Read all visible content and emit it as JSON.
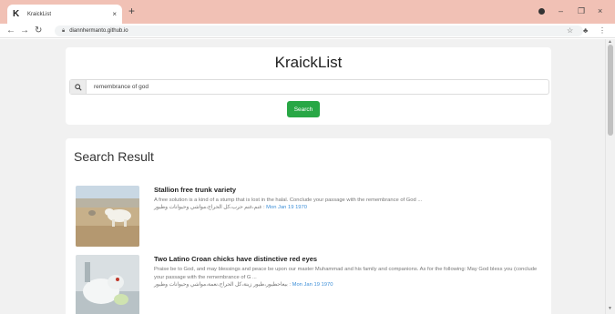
{
  "browser": {
    "tab_favicon": "K",
    "tab_title": "KraickList",
    "tab_close": "×",
    "new_tab": "+",
    "url": "diannhermanto.github.io",
    "minimize": "–",
    "maximize": "❐",
    "close": "×"
  },
  "page": {
    "site_title": "KraickList",
    "search": {
      "value": "remembrance of god",
      "button_label": "Search"
    },
    "results_heading": "Search Result",
    "results": [
      {
        "title": "Stallion free trunk variety",
        "description": "A free solution is a kind of a stump that is lost in the halal. Conclude your passage with the remembrance of God ...",
        "tags": "غنم،غنم حرب،كل الحراج،مواشي وحيوانات وطيور : ",
        "date": "Mon Jan 19 1970"
      },
      {
        "title": "Two Latino Croan chicks have distinctive red eyes",
        "description": "Praise be to God, and may blessings and peace be upon our master Muhammad and his family and companions. As for the following: May God bless you (conclude your passage with the remembrance of G ...",
        "tags": "بيعاحطيور،طيور زينة،كل الحراج،نعمة،مواشي وحيوانات وطيور : ",
        "date": "Mon Jan 19 1970"
      }
    ]
  },
  "colors": {
    "tab_strip": "#f1c1b5",
    "button_green": "#28a745",
    "link_blue": "#3d8fd8"
  },
  "icons": [
    "back-arrow-icon",
    "forward-arrow-icon",
    "reload-icon",
    "lock-icon",
    "star-icon",
    "extension-icon",
    "menu-dots-icon",
    "search-icon"
  ]
}
